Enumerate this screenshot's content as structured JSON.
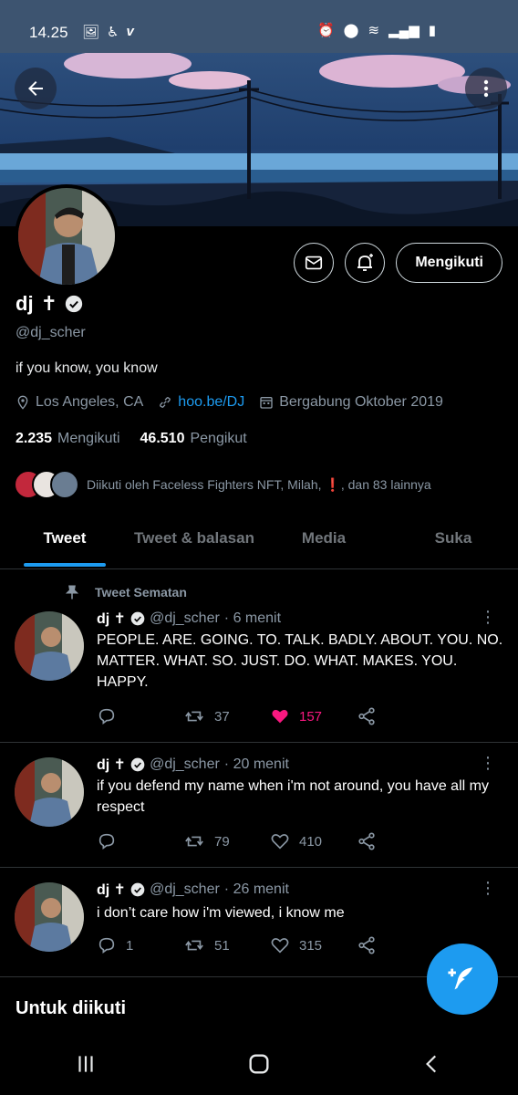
{
  "status_bar": {
    "time": "14.25",
    "left_icons": [
      "image-icon",
      "accessibility-icon",
      "vimeo-icon"
    ],
    "right_icons": [
      "alarm-icon",
      "location-icon",
      "wifi-icon",
      "signal-icon",
      "battery-charging-icon"
    ]
  },
  "profile": {
    "name": "dj",
    "name_symbol": "✝",
    "handle": "@dj_scher",
    "bio": "if you know, you know",
    "location": "Los Angeles, CA",
    "link": "hoo.be/DJ",
    "joined": "Bergabung Oktober 2019",
    "following_count": "2.235",
    "following_label": "Mengikuti",
    "followers_count": "46.510",
    "followers_label": "Pengikut",
    "followed_by_text": "Diikuti oleh Faceless Fighters NFT, Milah, ❗, dan 83 lainnya",
    "follow_button": "Mengikuti"
  },
  "tabs": [
    {
      "label": "Tweet",
      "active": true
    },
    {
      "label": "Tweet & balasan",
      "active": false
    },
    {
      "label": "Media",
      "active": false
    },
    {
      "label": "Suka",
      "active": false
    }
  ],
  "pinned_label": "Tweet Sematan",
  "tweets": [
    {
      "name": "dj ✝",
      "handle": "@dj_scher",
      "time": "· 6 menit",
      "text": "PEOPLE. ARE. GOING. TO. TALK. BADLY. ABOUT. YOU. NO. MATTER. WHAT. SO. JUST. DO. WHAT. MAKES. YOU. HAPPY.",
      "replies": "",
      "retweets": "37",
      "likes": "157",
      "liked": true
    },
    {
      "name": "dj ✝",
      "handle": "@dj_scher",
      "time": "· 20 menit",
      "text": "if you defend my name when i'm not around, you have all my respect",
      "replies": "",
      "retweets": "79",
      "likes": "410",
      "liked": false
    },
    {
      "name": "dj ✝",
      "handle": "@dj_scher",
      "time": "· 26 menit",
      "text": "i don’t care how i'm viewed, i know me",
      "replies": "1",
      "retweets": "51",
      "likes": "315",
      "liked": false
    }
  ],
  "suggest_title": "Untuk diikuti",
  "colors": {
    "accent": "#1d9bf0",
    "like": "#f91880",
    "status_bar": "#3d5470"
  }
}
